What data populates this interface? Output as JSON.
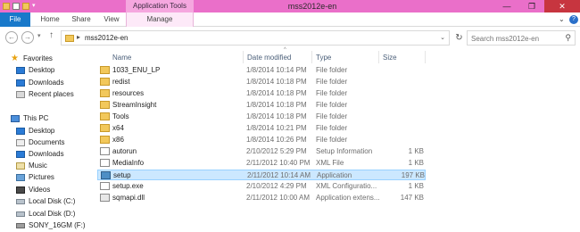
{
  "window": {
    "title": "mss2012e-en",
    "context_tab": "Application Tools",
    "minimize": "—",
    "maximize": "❐",
    "close": "✕"
  },
  "ribbon": {
    "tabs": [
      {
        "label": "File",
        "active": true
      },
      {
        "label": "Home"
      },
      {
        "label": "Share"
      },
      {
        "label": "View"
      },
      {
        "label": "Manage"
      }
    ]
  },
  "address": {
    "path": "mss2012e-en",
    "separator": "▸"
  },
  "search": {
    "placeholder": "Search mss2012e-en"
  },
  "nav_pane": {
    "favorites_header": "Favorites",
    "favorites": [
      "Desktop",
      "Downloads",
      "Recent places"
    ],
    "this_pc_header": "This PC",
    "this_pc": [
      "Desktop",
      "Documents",
      "Downloads",
      "Music",
      "Pictures",
      "Videos",
      "Local Disk (C:)",
      "Local Disk (D:)",
      "SONY_16GM (F:)"
    ]
  },
  "columns": {
    "name": "Name",
    "date_modified": "Date modified",
    "type": "Type",
    "size": "Size"
  },
  "files": [
    {
      "name": "1033_ENU_LP",
      "date": "1/8/2014 10:14 PM",
      "type": "File folder",
      "size": "",
      "icon": "folder-icon"
    },
    {
      "name": "redist",
      "date": "1/8/2014 10:18 PM",
      "type": "File folder",
      "size": "",
      "icon": "folder-icon"
    },
    {
      "name": "resources",
      "date": "1/8/2014 10:18 PM",
      "type": "File folder",
      "size": "",
      "icon": "folder-icon"
    },
    {
      "name": "StreamInsight",
      "date": "1/8/2014 10:18 PM",
      "type": "File folder",
      "size": "",
      "icon": "folder-icon"
    },
    {
      "name": "Tools",
      "date": "1/8/2014 10:18 PM",
      "type": "File folder",
      "size": "",
      "icon": "folder-icon"
    },
    {
      "name": "x64",
      "date": "1/8/2014 10:21 PM",
      "type": "File folder",
      "size": "",
      "icon": "folder-icon"
    },
    {
      "name": "x86",
      "date": "1/8/2014 10:26 PM",
      "type": "File folder",
      "size": "",
      "icon": "folder-icon"
    },
    {
      "name": "autorun",
      "date": "2/10/2012 5:29 PM",
      "type": "Setup Information",
      "size": "1 KB",
      "icon": "setup-info-icon"
    },
    {
      "name": "MediaInfo",
      "date": "2/11/2012 10:40 PM",
      "type": "XML File",
      "size": "1 KB",
      "icon": "xml-file-icon"
    },
    {
      "name": "setup",
      "date": "2/11/2012 10:14 AM",
      "type": "Application",
      "size": "197 KB",
      "icon": "application-icon",
      "selected": true
    },
    {
      "name": "setup.exe",
      "date": "2/10/2012 4:29 PM",
      "type": "XML Configuratio...",
      "size": "1 KB",
      "icon": "config-file-icon"
    },
    {
      "name": "sqmapi.dll",
      "date": "2/11/2012 10:00 AM",
      "type": "Application extens...",
      "size": "147 KB",
      "icon": "dll-file-icon"
    }
  ]
}
